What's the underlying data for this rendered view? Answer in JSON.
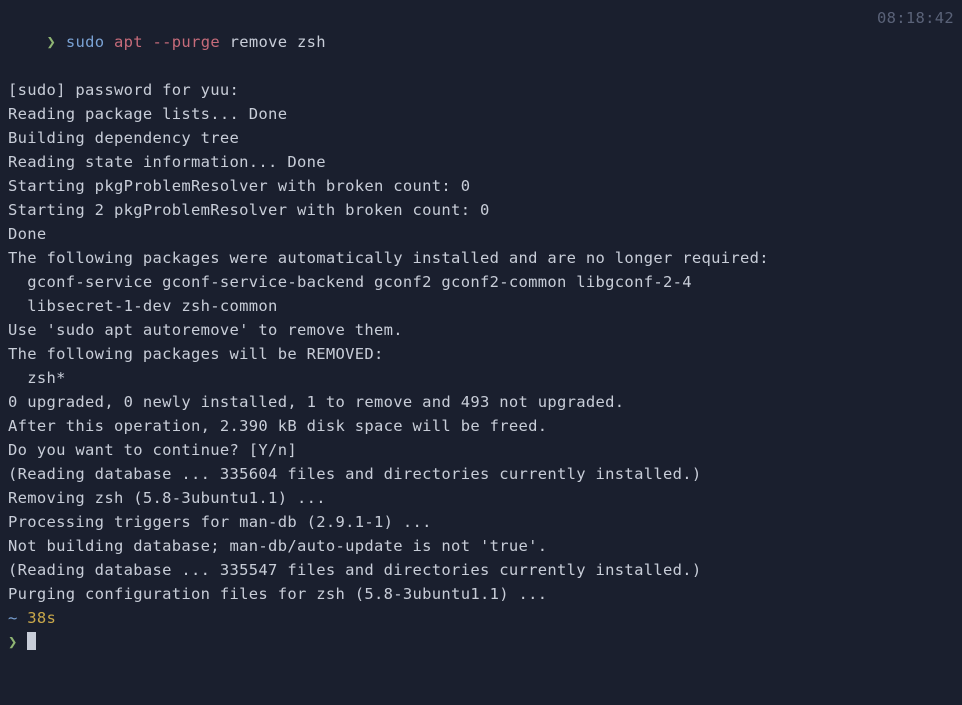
{
  "prompt": {
    "symbol": "❯",
    "sudo": "sudo",
    "command": "apt",
    "flag": "--purge",
    "action": "remove",
    "package": "zsh",
    "timestamp": "08:18:42"
  },
  "output": {
    "l1": "[sudo] password for yuu:",
    "l2": "Reading package lists... Done",
    "l3": "Building dependency tree",
    "l4": "Reading state information... Done",
    "l5": "Starting pkgProblemResolver with broken count: 0",
    "l6": "Starting 2 pkgProblemResolver with broken count: 0",
    "l7": "Done",
    "l8": "The following packages were automatically installed and are no longer required:",
    "l9": "  gconf-service gconf-service-backend gconf2 gconf2-common libgconf-2-4",
    "l10": "  libsecret-1-dev zsh-common",
    "l11": "Use 'sudo apt autoremove' to remove them.",
    "l12": "The following packages will be REMOVED:",
    "l13": "  zsh*",
    "l14": "0 upgraded, 0 newly installed, 1 to remove and 493 not upgraded.",
    "l15": "After this operation, 2.390 kB disk space will be freed.",
    "l16": "Do you want to continue? [Y/n]",
    "l17": "(Reading database ... 335604 files and directories currently installed.)",
    "l18": "Removing zsh (5.8-3ubuntu1.1) ...",
    "l19": "Processing triggers for man-db (2.9.1-1) ...",
    "l20": "Not building database; man-db/auto-update is not 'true'.",
    "l21": "(Reading database ... 335547 files and directories currently installed.)",
    "l22": "Purging configuration files for zsh (5.8-3ubuntu1.1) ..."
  },
  "status": {
    "tilde": "~",
    "duration": "38s"
  },
  "prompt2": {
    "symbol": "❯"
  }
}
